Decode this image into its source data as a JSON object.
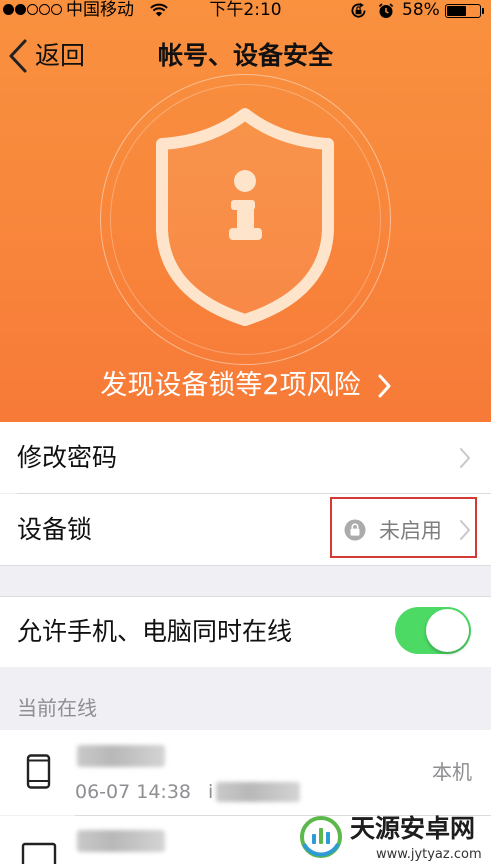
{
  "colors": {
    "accent_orange": "#f7843a",
    "toggle_on": "#4cd964",
    "annotation_red": "#d43a34",
    "chevron_gray": "#c7c7cc",
    "secondary_text": "#8e8e93"
  },
  "status_bar": {
    "signal_filled": 2,
    "signal_total": 5,
    "carrier": "中国移动",
    "wifi_icon": "wifi-icon",
    "time": "下午2:10",
    "rotation_lock_icon": "rotation-lock-icon",
    "alarm_icon": "alarm-icon",
    "battery_text": "58%",
    "battery_level": 0.58
  },
  "nav": {
    "back_icon": "chevron-left-icon",
    "back_label": "返回",
    "title": "帐号、设备安全"
  },
  "hero": {
    "icon": "shield-info-icon",
    "risk_text": "发现设备锁等2项风险",
    "risk_arrow_icon": "chevron-right-icon"
  },
  "security_rows": [
    {
      "label": "修改密码",
      "chevron_icon": "chevron-right-icon"
    },
    {
      "label": "设备锁",
      "status_icon": "lock-icon",
      "status": "未启用",
      "chevron_icon": "chevron-right-icon",
      "highlighted": true
    }
  ],
  "multi_online": {
    "label": "允许手机、电脑同时在线",
    "enabled": true
  },
  "online_section": {
    "header": "当前在线",
    "devices": [
      {
        "icon": "phone-icon",
        "time": "06-07 14:38",
        "model_fragment": "i",
        "tag": "本机"
      },
      {
        "icon": "computer-icon"
      }
    ]
  },
  "watermark": {
    "brand": "天源安卓网",
    "url": "www.jytyaz.com"
  }
}
